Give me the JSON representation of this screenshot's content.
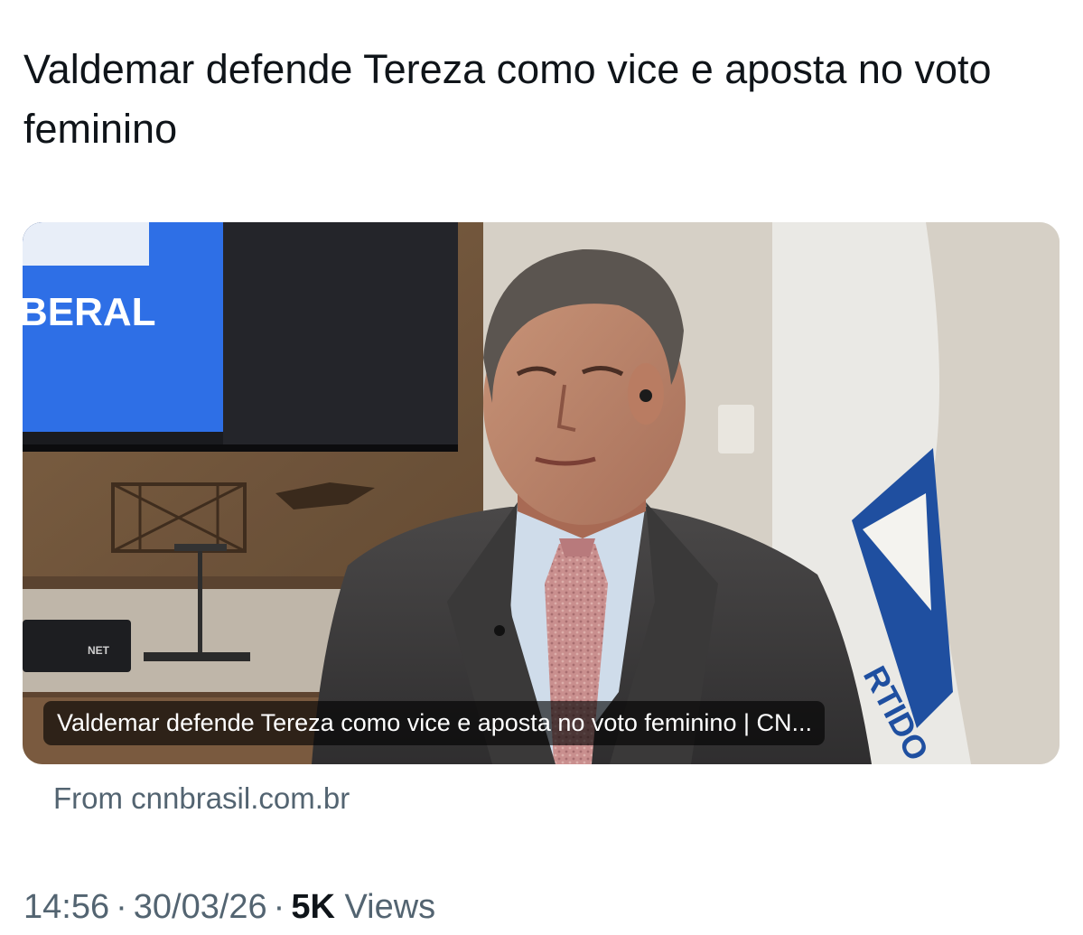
{
  "tweet": {
    "text": "Valdemar defende Tereza como vice e aposta no voto feminino"
  },
  "card": {
    "caption": "Valdemar defende Tereza como vice e aposta no voto feminino | CN...",
    "source": "From cnnbrasil.com.br",
    "image_texts": {
      "screen_logo": "BERAL",
      "tv_box_brand": "NET",
      "flag_text": "RTIDO"
    }
  },
  "meta": {
    "time": "14:56",
    "separator": "·",
    "date": "30/03/26",
    "views_count": "5K",
    "views_label": "Views"
  }
}
